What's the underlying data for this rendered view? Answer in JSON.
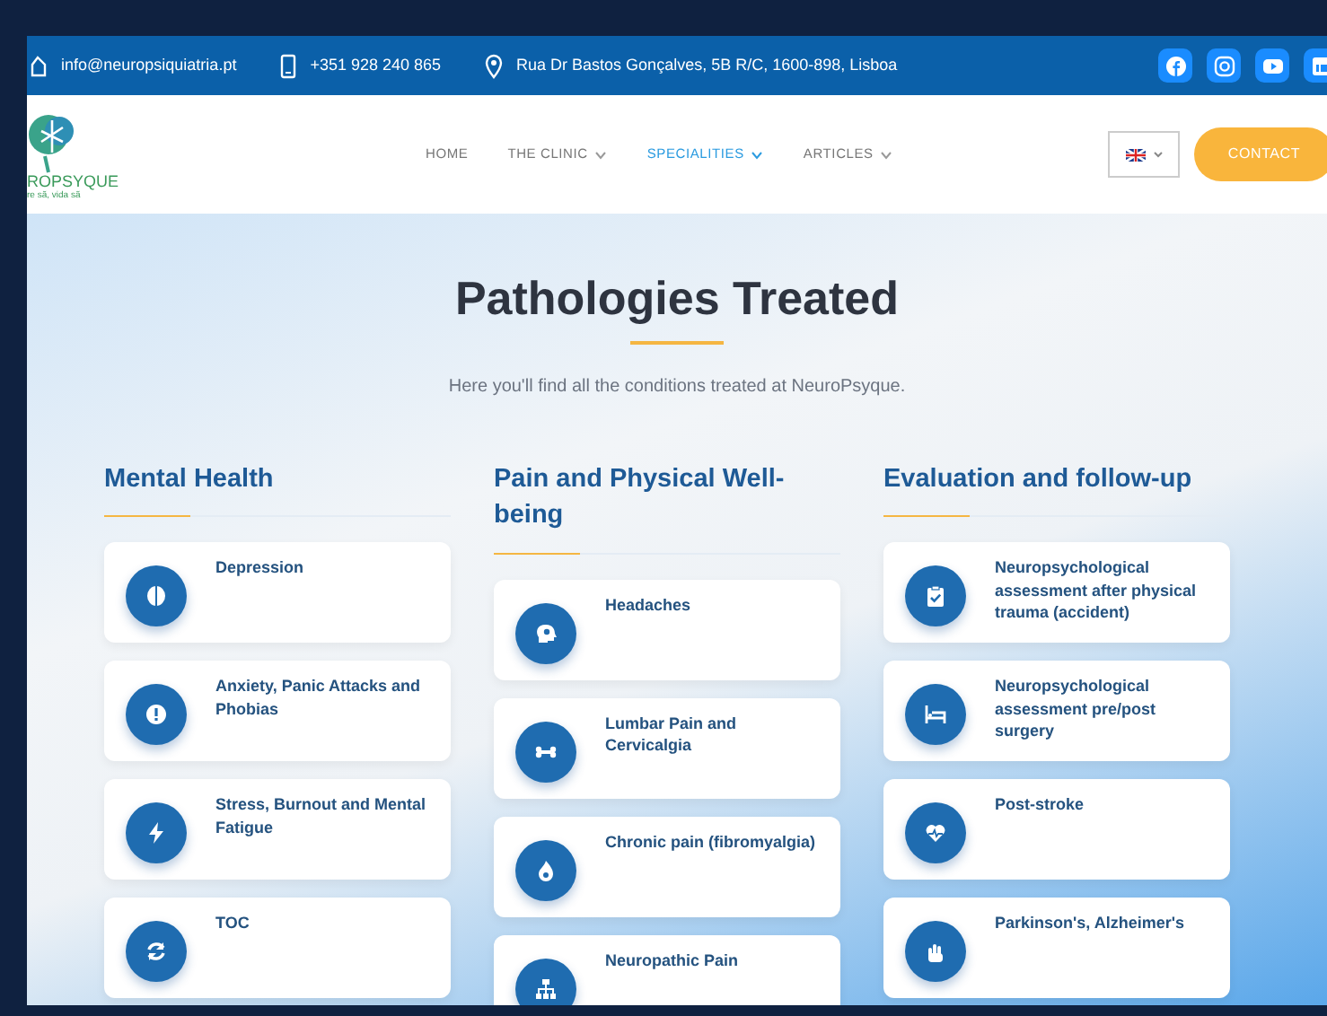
{
  "top_bar": {
    "email": "info@neuropsiquiatria.pt",
    "phone": "+351 928 240 865",
    "address": "Rua Dr Bastos Gonçalves, 5B R/C, 1600-898, Lisboa",
    "social": [
      {
        "kind": "facebook"
      },
      {
        "kind": "instagram"
      },
      {
        "kind": "youtube"
      },
      {
        "kind": "linkedin"
      }
    ]
  },
  "header": {
    "logo_text": "ROPSYQUE",
    "logo_tagline": "re sã, vida sã",
    "nav": [
      {
        "label": "HOME",
        "selected": false,
        "dropdown": false
      },
      {
        "label": "THE CLINIC",
        "selected": false,
        "dropdown": true
      },
      {
        "label": "SPECIALITIES",
        "selected": true,
        "dropdown": true
      },
      {
        "label": "ARTICLES",
        "selected": false,
        "dropdown": true
      }
    ],
    "language": {
      "kind": "uk-flag"
    },
    "contact_button": "CONTACT"
  },
  "hero": {
    "title": "Pathologies Treated",
    "subtitle": "Here you'll find all the conditions treated at NeuroPsyque."
  },
  "columns": [
    {
      "title": "Mental Health",
      "items": [
        {
          "label": "Depression"
        },
        {
          "label": "Anxiety, Panic Attacks and Phobias"
        },
        {
          "label": "Stress, Burnout and Mental Fatigue"
        },
        {
          "label": "TOC"
        }
      ]
    },
    {
      "title": "Pain and Physical Well-being",
      "items": [
        {
          "label": "Headaches"
        },
        {
          "label": "Lumbar Pain and Cervicalgia"
        },
        {
          "label": "Chronic pain (fibromyalgia)"
        },
        {
          "label": "Neuropathic Pain"
        }
      ]
    },
    {
      "title": "Evaluation and follow-up",
      "items": [
        {
          "label": "Neuropsychological assessment after physical trauma (accident)"
        },
        {
          "label": "Neuropsychological assessment pre/post surgery"
        },
        {
          "label": "Post-stroke"
        },
        {
          "label": "Parkinson's, Alzheimer's"
        }
      ]
    }
  ]
}
